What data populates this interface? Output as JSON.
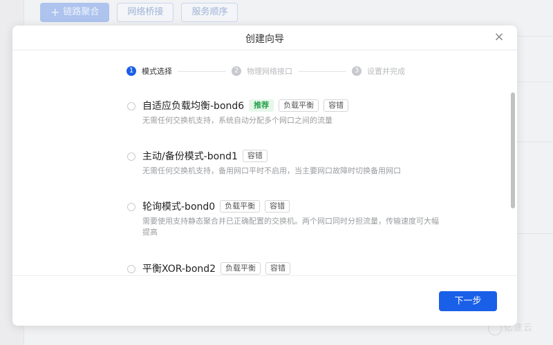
{
  "background": {
    "toolbar": {
      "link_aggregation": "链路聚合",
      "network_bridge": "网络桥接",
      "service_order": "服务顺序"
    },
    "watermark": "亿速云"
  },
  "modal": {
    "title": "创建向导",
    "close": "×",
    "steps": [
      {
        "num": "1",
        "label": "模式选择",
        "active": true
      },
      {
        "num": "2",
        "label": "物理网络接口",
        "active": false
      },
      {
        "num": "3",
        "label": "设置并完成",
        "active": false
      }
    ],
    "options": [
      {
        "title": "自适应负载均衡-bond6",
        "tags": [
          "推荐",
          "负载平衡",
          "容错"
        ],
        "desc": "无需任何交换机支持，系统自动分配多个网口之间的流量"
      },
      {
        "title": "主动/备份模式-bond1",
        "tags": [
          "容错"
        ],
        "desc": "无需任何交换机支持，备用网口平时不启用，当主要网口故障时切换备用网口"
      },
      {
        "title": "轮询模式-bond0",
        "tags": [
          "负载平衡",
          "容错"
        ],
        "desc": "需要使用支持静态聚合并已正确配置的交换机。两个网口同时分担流量，传输速度可大幅提高"
      },
      {
        "title": "平衡XOR-bond2",
        "tags": [
          "负载平衡",
          "容错"
        ],
        "desc": ""
      }
    ],
    "next_button": "下一步"
  },
  "colors": {
    "primary": "#1a5fe8",
    "recommend_bg": "#e6f7ea",
    "recommend_text": "#27a24a"
  }
}
